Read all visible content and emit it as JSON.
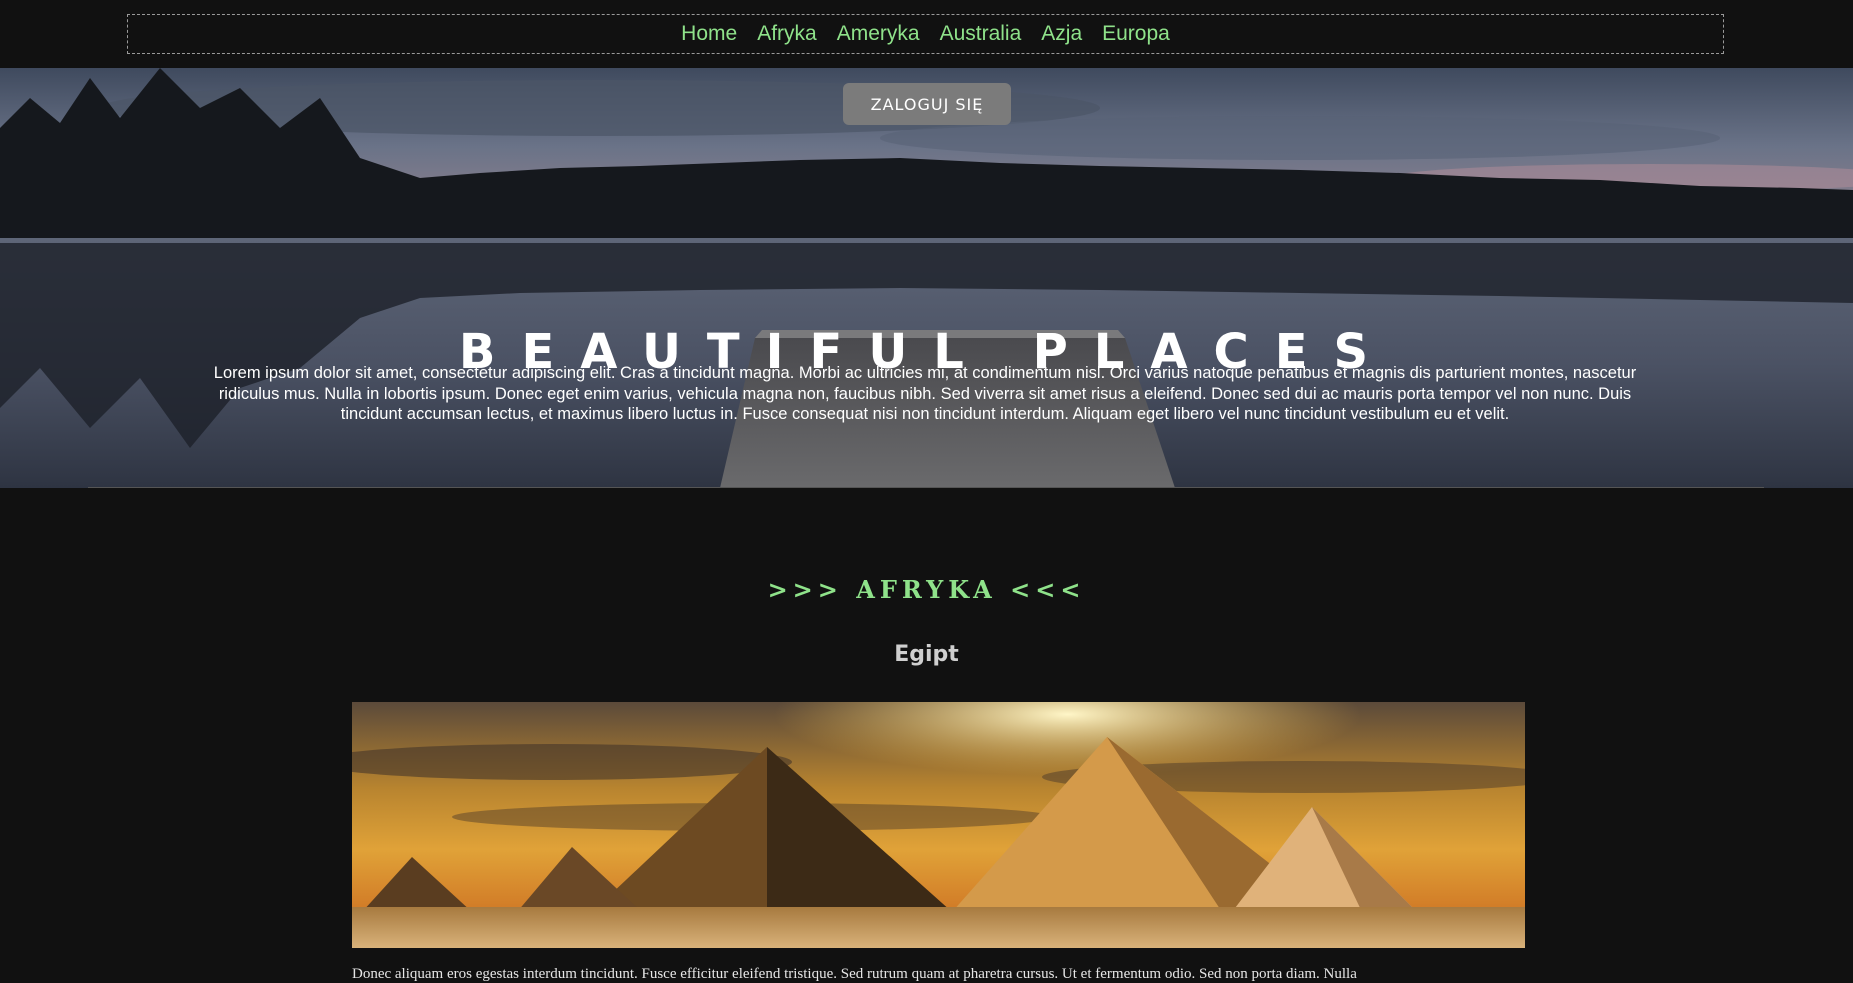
{
  "nav": {
    "items": [
      {
        "label": "Home"
      },
      {
        "label": "Afryka"
      },
      {
        "label": "Ameryka"
      },
      {
        "label": "Australia"
      },
      {
        "label": "Azja"
      },
      {
        "label": "Europa"
      }
    ]
  },
  "hero": {
    "login_label": "ZALOGUJ SIĘ",
    "title": "BEAUTIFUL PLACES",
    "text": "Lorem ipsum dolor sit amet, consectetur adipiscing elit. Cras a tincidunt magna. Morbi ac ultricies mi, at condimentum nisl. Orci varius natoque penatibus et magnis dis parturient montes, nascetur ridiculus mus. Nulla in lobortis ipsum. Donec eget enim varius, vehicula magna non, faucibus nibh. Sed viverra sit amet risus a eleifend. Donec sed dui ac mauris porta tempor vel non nunc. Duis tincidunt accumsan lectus, et maximus libero luctus in. Fusce consequat nisi non tincidunt interdum. Aliquam eget libero vel nunc tincidunt vestibulum eu et velit."
  },
  "section": {
    "title": ">>> AFRYKA <<<",
    "place": {
      "title": "Egipt",
      "text": "Donec aliquam eros egestas interdum tincidunt. Fusce efficitur eleifend tristique. Sed rutrum quam at pharetra cursus. Ut et fermentum odio. Sed non porta diam. Nulla"
    }
  },
  "colors": {
    "accent": "#8fe28a",
    "background": "#111111",
    "button": "#7b7b7b"
  }
}
